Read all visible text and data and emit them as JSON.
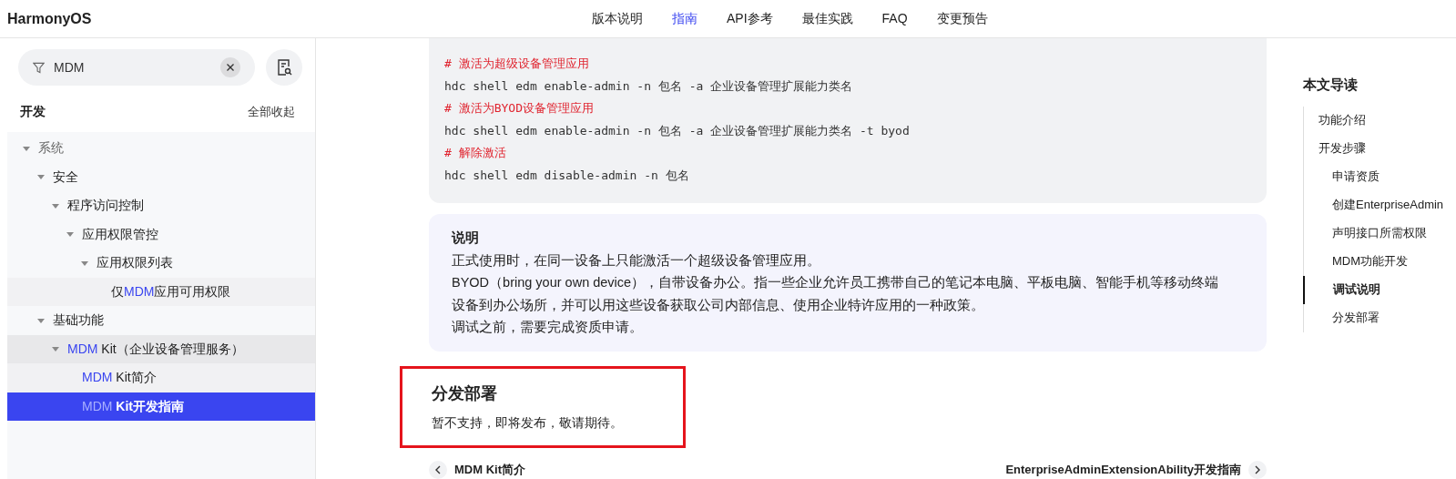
{
  "header": {
    "logo": "HarmonyOS",
    "nav": [
      {
        "label": "版本说明",
        "selected": false
      },
      {
        "label": "指南",
        "selected": true
      },
      {
        "label": "API参考",
        "selected": false
      },
      {
        "label": "最佳实践",
        "selected": false
      },
      {
        "label": "FAQ",
        "selected": false
      },
      {
        "label": "变更预告",
        "selected": false
      }
    ]
  },
  "sidebar": {
    "filter": {
      "value": "MDM"
    },
    "section_title": "开发",
    "collapse_all": "全部收起",
    "tree": [
      {
        "parts": [
          {
            "text": "系统",
            "match": false
          }
        ],
        "expanded": true,
        "selected": false,
        "children": [
          {
            "parts": [
              {
                "text": "安全",
                "match": false
              }
            ],
            "expanded": true,
            "selected": false,
            "children": [
              {
                "parts": [
                  {
                    "text": "程序访问控制",
                    "match": false
                  }
                ],
                "expanded": true,
                "selected": false,
                "children": [
                  {
                    "parts": [
                      {
                        "text": "应用权限管控",
                        "match": false
                      }
                    ],
                    "expanded": true,
                    "selected": false,
                    "children": [
                      {
                        "parts": [
                          {
                            "text": "应用权限列表",
                            "match": false
                          }
                        ],
                        "expanded": true,
                        "selected": false,
                        "children": [
                          {
                            "parts": [
                              {
                                "text": "仅",
                                "match": false
                              },
                              {
                                "text": "MDM",
                                "match": true
                              },
                              {
                                "text": "应用可用权限",
                                "match": false
                              }
                            ],
                            "selected": false
                          }
                        ]
                      }
                    ]
                  }
                ]
              }
            ]
          },
          {
            "parts": [
              {
                "text": "基础功能",
                "match": false
              }
            ],
            "expanded": true,
            "selected": false,
            "children": [
              {
                "parts": [
                  {
                    "text": "MDM",
                    "match": true
                  },
                  {
                    "text": " Kit（企业设备管理服务）",
                    "match": false
                  }
                ],
                "expanded": true,
                "selected": false,
                "children": [
                  {
                    "parts": [
                      {
                        "text": "MDM",
                        "match": true
                      },
                      {
                        "text": " Kit简介",
                        "match": false
                      }
                    ],
                    "selected": false
                  },
                  {
                    "parts": [
                      {
                        "text": "MDM",
                        "match": true
                      },
                      {
                        "text": " Kit开发指南",
                        "match": false
                      }
                    ],
                    "selected": true
                  }
                ]
              }
            ]
          }
        ]
      }
    ]
  },
  "content": {
    "code": [
      {
        "kind": "comment",
        "text": "# 激活为超级设备管理应用"
      },
      {
        "kind": "command",
        "text": "hdc shell edm enable-admin -n 包名 -a 企业设备管理扩展能力类名"
      },
      {
        "kind": "comment",
        "text": "# 激活为BYOD设备管理应用"
      },
      {
        "kind": "command",
        "text": "hdc shell edm enable-admin -n 包名 -a 企业设备管理扩展能力类名 -t byod"
      },
      {
        "kind": "comment",
        "text": "# 解除激活"
      },
      {
        "kind": "command",
        "text": "hdc shell edm disable-admin -n 包名"
      }
    ],
    "note": {
      "title": "说明",
      "paragraphs": [
        "正式使用时，在同一设备上只能激活一个超级设备管理应用。",
        "BYOD（bring your own device），自带设备办公。指一些企业允许员工携带自己的笔记本电脑、平板电脑、智能手机等移动终端设备到办公场所，并可以用这些设备获取公司内部信息、使用企业特许应用的一种政策。",
        "调试之前，需要完成资质申请。"
      ]
    },
    "section": {
      "heading": "分发部署",
      "text": "暂不支持，即将发布，敬请期待。",
      "highlighted": true
    },
    "pager": {
      "previous": "MDM Kit简介",
      "next": "EnterpriseAdminExtensionAbility开发指南"
    }
  },
  "toc": {
    "title": "本文导读",
    "items": [
      {
        "label": "功能介绍",
        "selected": false
      },
      {
        "label": "开发步骤",
        "selected": false,
        "children": [
          {
            "label": "申请资质",
            "selected": false
          },
          {
            "label": "创建EnterpriseAdmin",
            "selected": false
          },
          {
            "label": "声明接口所需权限",
            "selected": false
          },
          {
            "label": "MDM功能开发",
            "selected": false
          },
          {
            "label": "调试说明",
            "selected": true
          },
          {
            "label": "分发部署",
            "selected": false
          }
        ]
      }
    ]
  }
}
